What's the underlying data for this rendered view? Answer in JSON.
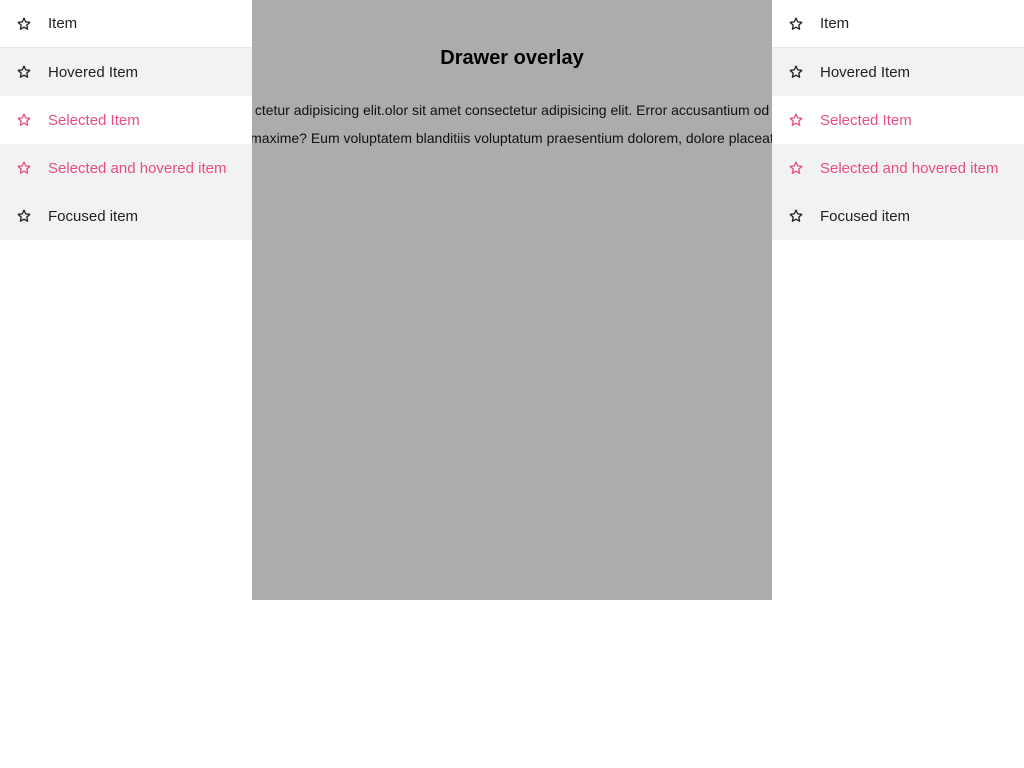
{
  "colors": {
    "accent": "#e84c8a",
    "overlay": "#acacac",
    "hover_bg": "#f2f2f2",
    "text": "#222222"
  },
  "content": {
    "title": "Drawer overlay",
    "line1": "ctetur adipisicing elit.olor sit amet consectetur adipisicing elit. Error accusantium od",
    "line2": "maxime? Eum voluptatem blanditiis voluptatum praesentium dolorem, dolore placeat"
  },
  "left_drawer": {
    "items": [
      {
        "label": "Item",
        "icon": "star-outline-icon",
        "state": "default"
      },
      {
        "label": "Hovered Item",
        "icon": "star-outline-icon",
        "state": "hovered"
      },
      {
        "label": "Selected Item",
        "icon": "star-outline-icon",
        "state": "selected"
      },
      {
        "label": "Selected and hovered item",
        "icon": "star-outline-icon",
        "state": "selected-hovered"
      },
      {
        "label": "Focused item",
        "icon": "star-outline-icon",
        "state": "focused"
      }
    ]
  },
  "right_drawer": {
    "items": [
      {
        "label": "Item",
        "icon": "star-outline-icon",
        "state": "default"
      },
      {
        "label": "Hovered Item",
        "icon": "star-outline-icon",
        "state": "hovered"
      },
      {
        "label": "Selected Item",
        "icon": "star-outline-icon",
        "state": "selected"
      },
      {
        "label": "Selected and hovered item",
        "icon": "star-outline-icon",
        "state": "selected-hovered"
      },
      {
        "label": "Focused item",
        "icon": "star-outline-icon",
        "state": "focused"
      }
    ]
  }
}
